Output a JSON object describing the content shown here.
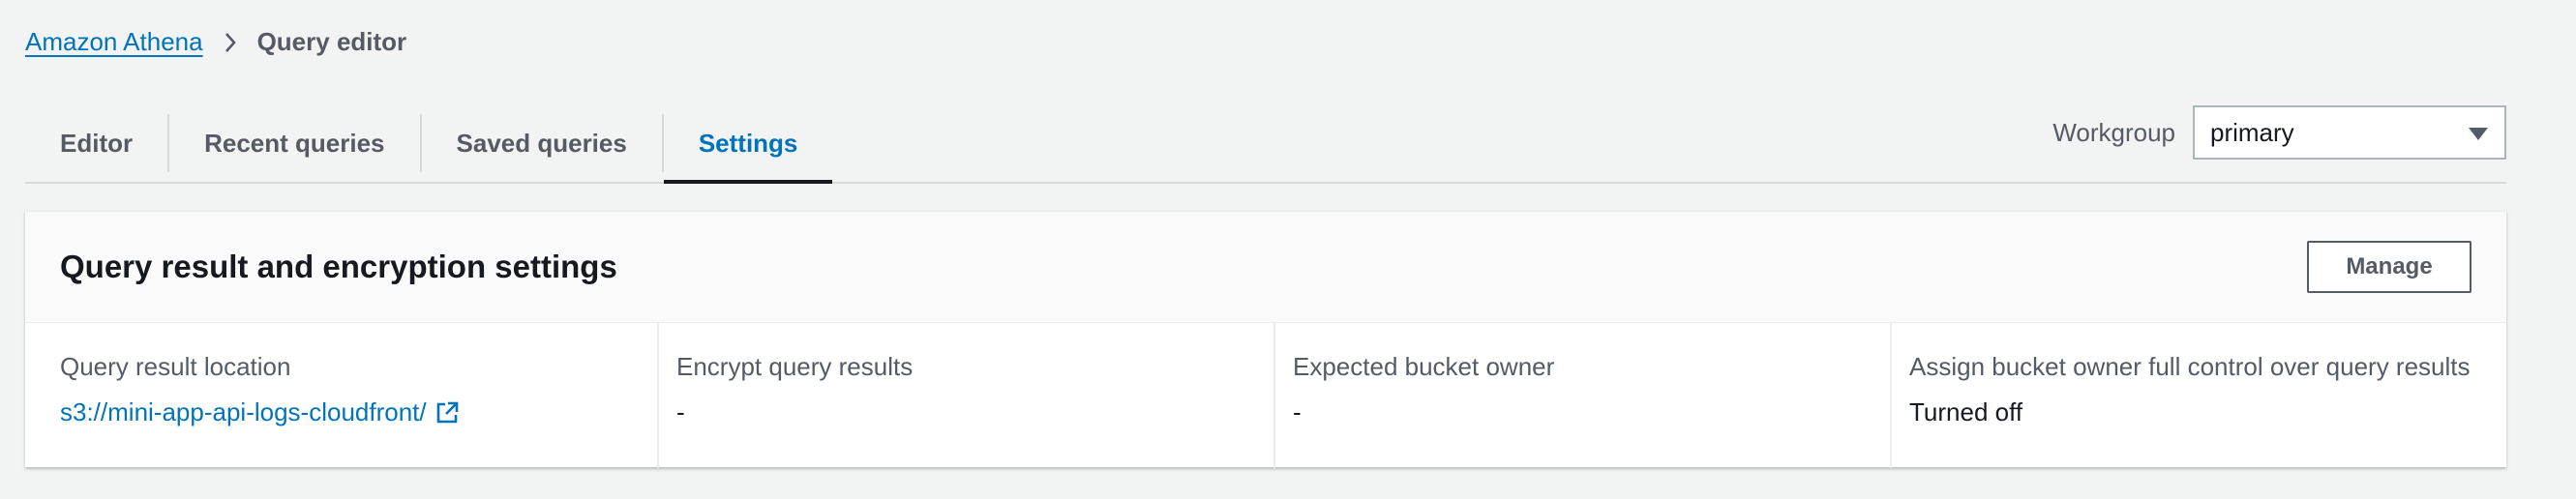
{
  "breadcrumb": {
    "root": "Amazon Athena",
    "separator_icon": "chevron-right-icon",
    "current": "Query editor"
  },
  "tabs": [
    {
      "label": "Editor",
      "active": false
    },
    {
      "label": "Recent queries",
      "active": false
    },
    {
      "label": "Saved queries",
      "active": false
    },
    {
      "label": "Settings",
      "active": true
    }
  ],
  "workgroup": {
    "label": "Workgroup",
    "value": "primary",
    "dropdown_icon": "caret-down-icon"
  },
  "panel": {
    "title": "Query result and encryption settings",
    "manage_label": "Manage",
    "fields": [
      {
        "label": "Query result location",
        "value": "s3://mini-app-api-logs-cloudfront/",
        "link": true,
        "icon": "external-link-icon"
      },
      {
        "label": "Encrypt query results",
        "value": "-"
      },
      {
        "label": "Expected bucket owner",
        "value": "-"
      },
      {
        "label": "Assign bucket owner full control over query results",
        "value": "Turned off"
      }
    ]
  },
  "colors": {
    "background": "#f2f3f3",
    "link": "#0073bb",
    "text": "#16191f",
    "muted": "#545b64"
  }
}
